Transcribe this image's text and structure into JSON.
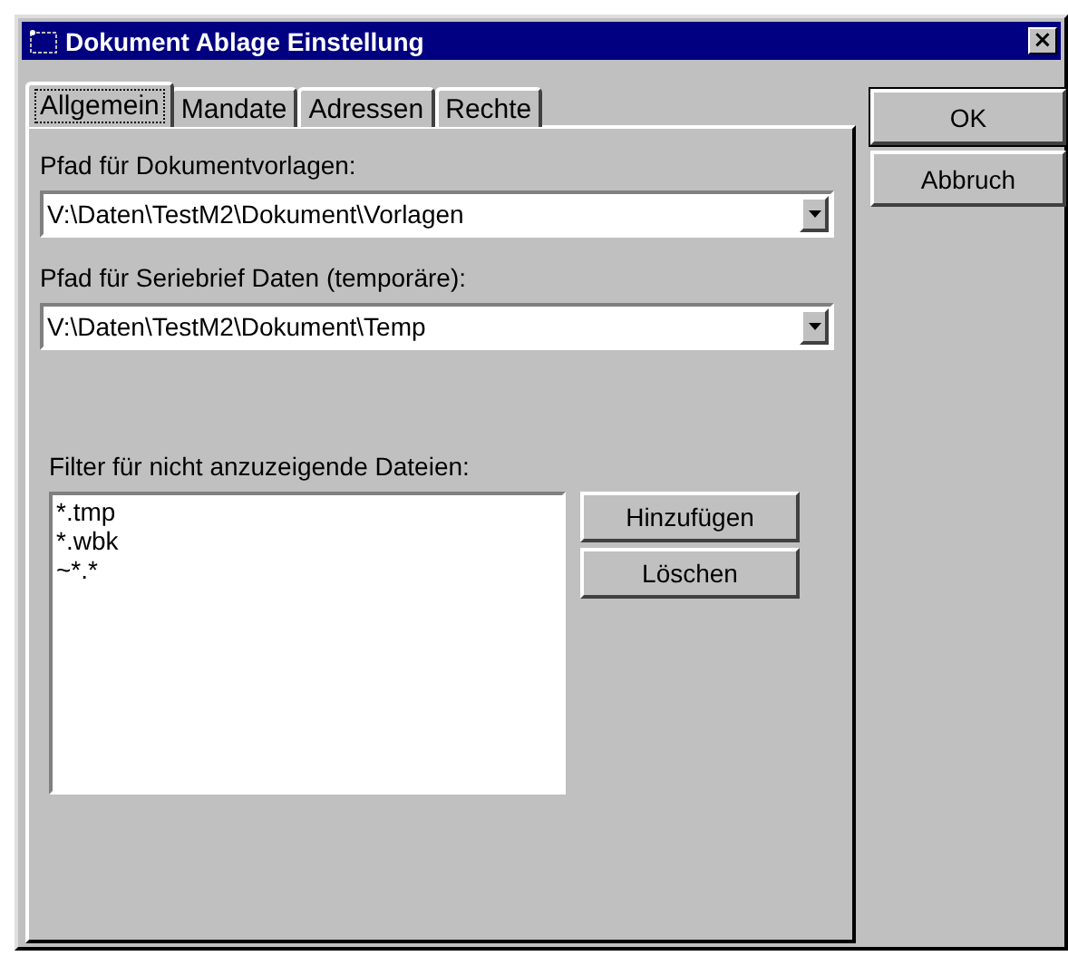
{
  "window": {
    "title": "Dokument Ablage Einstellung",
    "close": "×"
  },
  "tabs": [
    {
      "label": "Allgemein",
      "selected": true
    },
    {
      "label": "Mandate",
      "selected": false
    },
    {
      "label": "Adressen",
      "selected": false
    },
    {
      "label": "Rechte",
      "selected": false
    }
  ],
  "template_path": {
    "label": "Pfad für Dokumentvorlagen:",
    "value": "V:\\Daten\\TestM2\\Dokument\\Vorlagen"
  },
  "temp_path": {
    "label": "Pfad für Seriebrief Daten (temporäre):",
    "value": "V:\\Daten\\TestM2\\Dokument\\Temp"
  },
  "filter": {
    "label": "Filter für nicht anzuzeigende Dateien:",
    "items": [
      "*.tmp",
      "*.wbk",
      "~*.*"
    ],
    "buttons": [
      "Hinzufügen",
      "Löschen"
    ]
  },
  "buttons": [
    "OK",
    "Abbruch"
  ]
}
